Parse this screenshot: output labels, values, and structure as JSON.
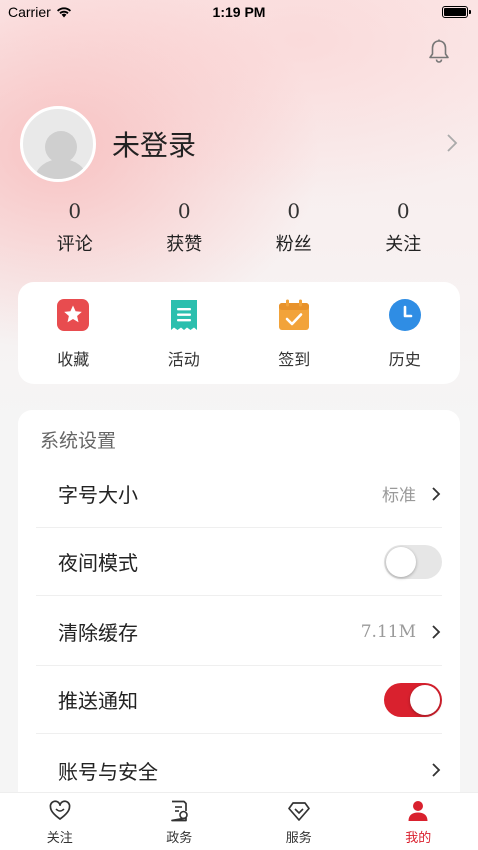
{
  "status_bar": {
    "carrier": "Carrier",
    "time": "1:19 PM"
  },
  "profile": {
    "username": "未登录"
  },
  "stats": [
    {
      "value": "0",
      "label": "评论"
    },
    {
      "value": "0",
      "label": "获赞"
    },
    {
      "value": "0",
      "label": "粉丝"
    },
    {
      "value": "0",
      "label": "关注"
    }
  ],
  "quick_actions": [
    {
      "label": "收藏",
      "icon": "star-icon",
      "color": "#e84c4f"
    },
    {
      "label": "活动",
      "icon": "receipt-icon",
      "color": "#2bbfae"
    },
    {
      "label": "签到",
      "icon": "calendar-check-icon",
      "color": "#f2a33a"
    },
    {
      "label": "历史",
      "icon": "clock-icon",
      "color": "#2f8de4"
    }
  ],
  "settings": {
    "title": "系统设置",
    "rows": [
      {
        "label": "字号大小",
        "value": "标准",
        "type": "link"
      },
      {
        "label": "夜间模式",
        "type": "toggle",
        "checked": false
      },
      {
        "label": "清除缓存",
        "value": "7.11M",
        "type": "link"
      },
      {
        "label": "推送通知",
        "type": "toggle",
        "checked": true
      },
      {
        "label": "账号与安全",
        "type": "link"
      }
    ]
  },
  "tabbar": [
    {
      "label": "关注",
      "icon": "heart-icon",
      "active": false
    },
    {
      "label": "政务",
      "icon": "document-icon",
      "active": false
    },
    {
      "label": "服务",
      "icon": "diamond-icon",
      "active": false
    },
    {
      "label": "我的",
      "icon": "user-icon",
      "active": true
    }
  ],
  "colors": {
    "accent": "#d9212e"
  }
}
